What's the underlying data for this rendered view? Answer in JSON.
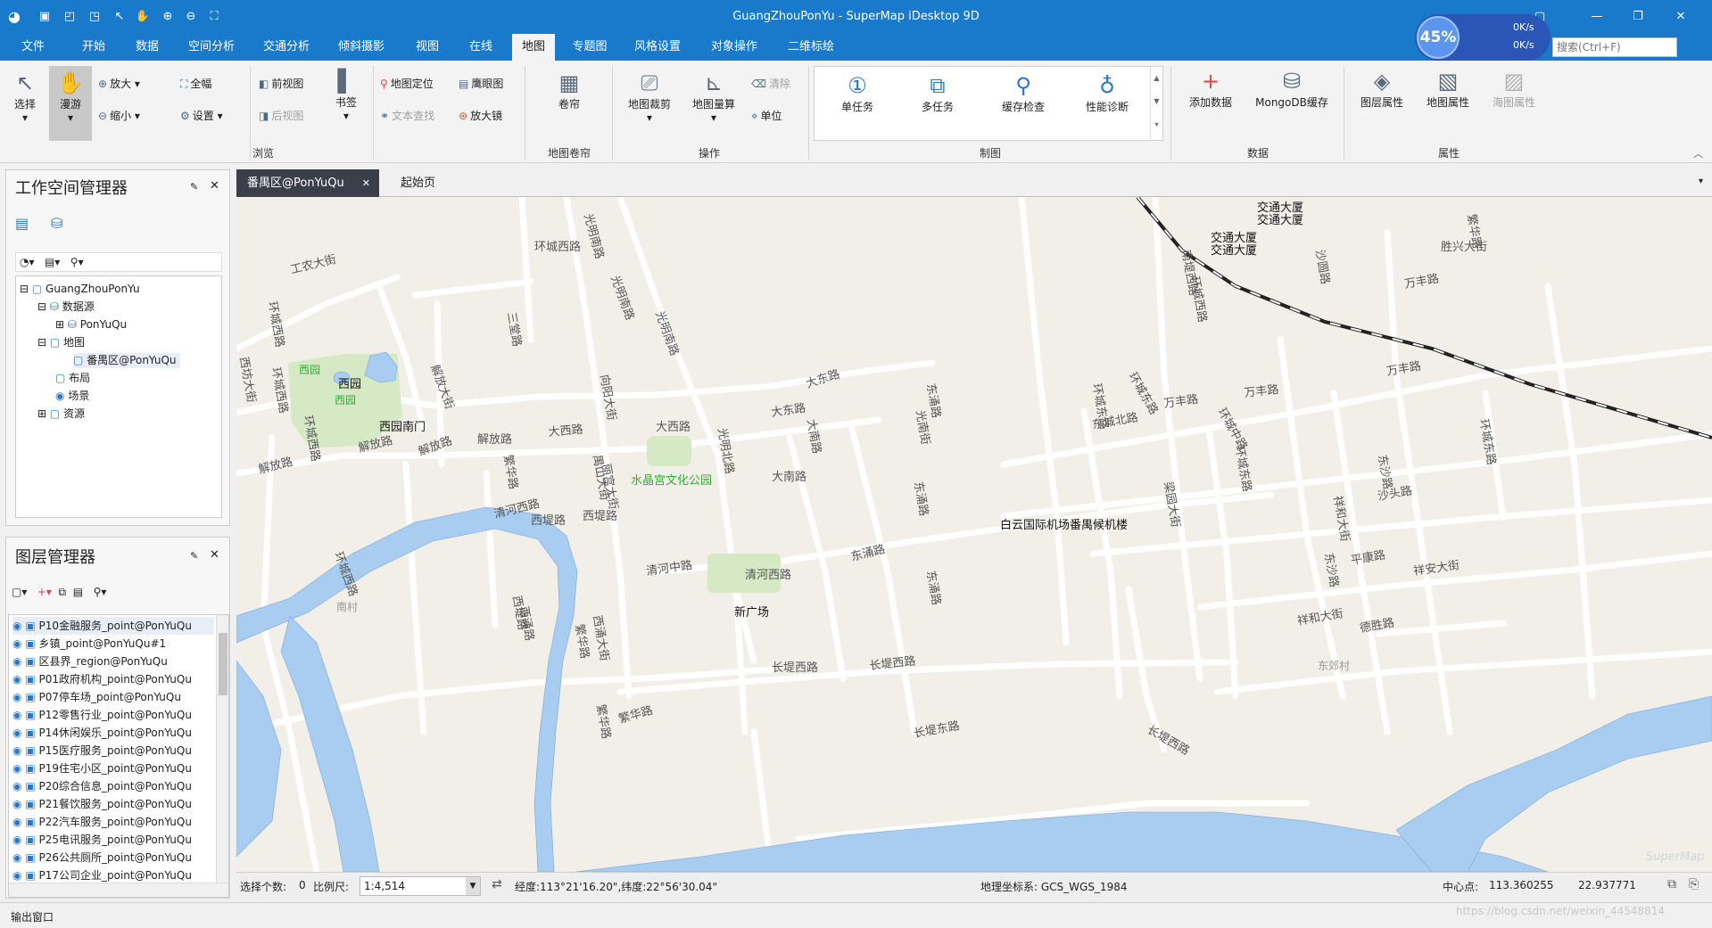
{
  "title_bar": {
    "title": "GuangZhouPonYu - SuperMap iDesktop 9D",
    "search_placeholder": "搜索(Ctrl+F)",
    "net_percent": "45%",
    "net_up": "0K/s",
    "net_down": "0K/s"
  },
  "menu": [
    "文件",
    "开始",
    "数据",
    "空间分析",
    "交通分析",
    "倾斜摄影",
    "视图",
    "在线",
    "地图",
    "专题图",
    "风格设置",
    "对象操作",
    "二维标绘"
  ],
  "ribbon": {
    "select": "选择",
    "pan": "漫游",
    "zoom_in": "放大",
    "zoom_out": "缩小",
    "full_extent": "全幅",
    "settings": "设置",
    "prev_view": "前视图",
    "next_view": "后视图",
    "bookmark": "书签",
    "map_locate": "地图定位",
    "text_find": "文本查找",
    "eagle_eye": "鹰眼图",
    "magnifier": "放大镜",
    "roller": "卷帘",
    "clip": "地图裁剪",
    "measure": "地图量算",
    "clear": "清除",
    "unit": "单位",
    "single_task": "单任务",
    "multi_task": "多任务",
    "cache_check": "缓存检查",
    "diagnose": "性能诊断",
    "add_data": "添加数据",
    "mongodb_cache": "MongoDB缓存",
    "layer_props": "图层属性",
    "map_props": "地图属性",
    "chart_props": "海图属性",
    "groups": {
      "browse": "浏览",
      "roller": "地图卷帘",
      "operate": "操作",
      "draw": "制图",
      "data": "数据",
      "props": "属性"
    }
  },
  "workspace": {
    "title": "工作空间管理器",
    "tree": [
      "GuangZhouPonYu",
      "数据源",
      "PonYuQu",
      "地图",
      "番禺区@PonYuQu",
      "布局",
      "场景",
      "资源"
    ]
  },
  "layers": {
    "title": "图层管理器",
    "items": [
      "P10金融服务_point@PonYuQu",
      "乡镇_point@PonYuQu#1",
      "区县界_region@PonYuQu",
      "P01政府机构_point@PonYuQu",
      "P07停车场_point@PonYuQu",
      "P12零售行业_point@PonYuQu",
      "P14休闲娱乐_point@PonYuQu",
      "P15医疗服务_point@PonYuQu",
      "P19住宅小区_point@PonYuQu",
      "P20综合信息_point@PonYuQu",
      "P21餐饮服务_point@PonYuQu",
      "P22汽车服务_point@PonYuQu",
      "P25电讯服务_point@PonYuQu",
      "P26公共厕所_point@PonYuQu",
      "P17公司企业_point@PonYuQu"
    ]
  },
  "tabs": {
    "active": "番禺区@PonYuQu",
    "other": "起始页"
  },
  "map_labels": {
    "roads": [
      "环城西路",
      "工农大街",
      "环城西路",
      "西坊大街",
      "环城西路",
      "环城西路",
      "解放大街",
      "解放路",
      "解放路",
      "解放路",
      "解放路",
      "三堂路",
      "光明南路",
      "光明南路",
      "光明南路",
      "环城西路",
      "大西路",
      "大西路",
      "大东路",
      "大东路",
      "向阳大街",
      "繁华路",
      "丽宫大街",
      "禺山大街",
      "光明北路",
      "大南路",
      "大南路",
      "光南街",
      "东涌路",
      "东涌路",
      "东涌路",
      "东涌路",
      "清河中路",
      "清河西路",
      "清河西路",
      "西堤路",
      "西堤路",
      "西堤路",
      "西涌路",
      "西涌大街",
      "繁华路",
      "繁华路",
      "繁华路",
      "长堤西路",
      "长堤西路",
      "长堤西路",
      "长堤东路",
      "南堤西路",
      "环城中路",
      "环城东路",
      "环城东路",
      "东城北路",
      "万丰路",
      "万丰路",
      "万丰路",
      "万丰路",
      "胜兴大街",
      "沙圆路",
      "沙头路",
      "平康路",
      "祥安大街",
      "祥和大街",
      "祥和大街",
      "德胜路",
      "东沙路",
      "东沙路",
      "环城东路",
      "环城西路",
      "梁园大街",
      "繁华路",
      "环城东路"
    ],
    "poi": [
      "西园",
      "西园",
      "西园",
      "西园南门",
      "水晶宫文化公园",
      "新广场",
      "白云国际机场番禺候机楼",
      "交通大厦",
      "交通大厦",
      "交通大厦",
      "交通大厦",
      "南村",
      "东郊村"
    ],
    "watermark": "SuperMap"
  },
  "status": {
    "select_count_label": "选择个数:",
    "select_count": "0",
    "scale_label": "比例尺:",
    "scale": "1:4,514",
    "coords": "经度:113°21'16.20\",纬度:22°56'30.04\"",
    "crs": "地理坐标系: GCS_WGS_1984",
    "center_label": "中心点:",
    "center_x": "113.360255",
    "center_y": "22.937771"
  },
  "output": {
    "label": "输出窗口",
    "url": "https://blog.csdn.net/weixin_44548814"
  },
  "colors": {
    "title_bar": "#1979ca",
    "park": "#d5e9c4",
    "water": "#a9cdf1",
    "map_bg": "#f2efe8",
    "road": "#ffffff"
  }
}
